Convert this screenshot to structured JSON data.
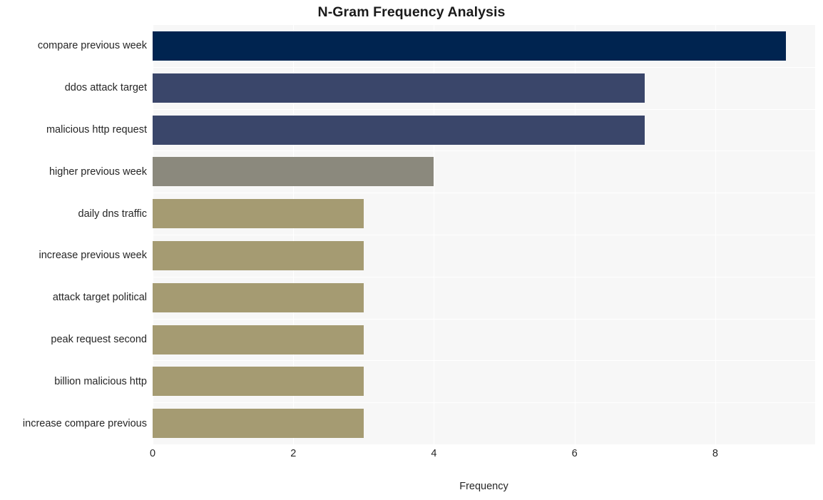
{
  "chart_data": {
    "type": "bar",
    "orientation": "horizontal",
    "title": "N-Gram Frequency Analysis",
    "xlabel": "Frequency",
    "ylabel": "",
    "xlim": [
      0,
      9.42
    ],
    "xticks": [
      0,
      2,
      4,
      6,
      8
    ],
    "xticklabels": [
      "0",
      "2",
      "4",
      "6",
      "8"
    ],
    "grid": true,
    "legend": "none",
    "categories": [
      "compare previous week",
      "ddos attack target",
      "malicious http request",
      "higher previous week",
      "daily dns traffic",
      "increase previous week",
      "attack target political",
      "peak request second",
      "billion malicious http",
      "increase compare previous"
    ],
    "values": [
      9,
      7,
      7,
      4,
      3,
      3,
      3,
      3,
      3,
      3
    ],
    "bar_colors": [
      "#002450",
      "#3a466a",
      "#3a466a",
      "#8b897d",
      "#a59b72",
      "#a59b72",
      "#a59b72",
      "#a59b72",
      "#a59b72",
      "#a59b72"
    ]
  },
  "style": {
    "figure_background": "#ffffff",
    "plot_background": "#f7f7f7",
    "gridline_color": "#ffffff",
    "text_color": "#262626",
    "title_color": "#1a1a1a"
  }
}
